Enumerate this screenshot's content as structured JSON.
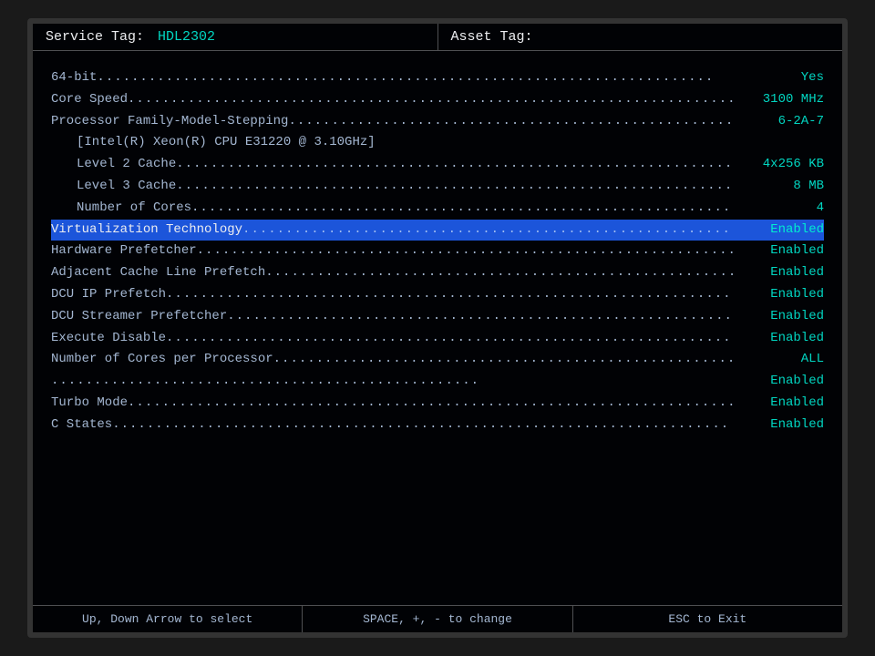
{
  "header": {
    "service_tag_label": "Service Tag:",
    "service_tag_value": "HDL2302",
    "asset_tag_label": "Asset Tag:"
  },
  "rows": [
    {
      "label": "64-bit",
      "dots": true,
      "value": "Yes",
      "highlighted": false,
      "indent": false
    },
    {
      "label": "Core Speed",
      "dots": true,
      "value": "3100 MHz",
      "highlighted": false,
      "indent": false
    },
    {
      "label": "Processor Family-Model-Stepping",
      "dots": true,
      "value": "6-2A-7",
      "highlighted": false,
      "indent": false
    },
    {
      "label": "[Intel(R) Xeon(R) CPU E31220 @ 3.10GHz]",
      "dots": false,
      "value": "",
      "highlighted": false,
      "indent": true
    },
    {
      "label": "Level 2 Cache",
      "dots": true,
      "value": "4x256 KB",
      "highlighted": false,
      "indent": true
    },
    {
      "label": "Level 3 Cache",
      "dots": true,
      "value": "8 MB",
      "highlighted": false,
      "indent": true
    },
    {
      "label": "Number of Cores",
      "dots": true,
      "value": "4",
      "highlighted": false,
      "indent": true
    },
    {
      "label": "Virtualization Technology",
      "dots": true,
      "value": "Enabled",
      "highlighted": true,
      "indent": false
    },
    {
      "label": "Hardware Prefetcher",
      "dots": true,
      "value": "Enabled",
      "highlighted": false,
      "indent": false
    },
    {
      "label": "Adjacent Cache Line Prefetch",
      "dots": true,
      "value": "Enabled",
      "highlighted": false,
      "indent": false
    },
    {
      "label": "DCU IP Prefetch",
      "dots": true,
      "value": "Enabled",
      "highlighted": false,
      "indent": false
    },
    {
      "label": "DCU Streamer Prefetcher",
      "dots": true,
      "value": "Enabled",
      "highlighted": false,
      "indent": false
    },
    {
      "label": "Execute Disable",
      "dots": true,
      "value": "Enabled",
      "highlighted": false,
      "indent": false
    },
    {
      "label": "Number of Cores per Processor",
      "dots": true,
      "value": "ALL",
      "highlighted": false,
      "indent": false
    },
    {
      "label": "",
      "dots": true,
      "value": "Enabled",
      "highlighted": false,
      "indent": false
    },
    {
      "label": "Turbo Mode",
      "dots": true,
      "value": "Enabled",
      "highlighted": false,
      "indent": false
    },
    {
      "label": "C States",
      "dots": true,
      "value": "Enabled",
      "highlighted": false,
      "indent": false
    }
  ],
  "footer": {
    "nav_label": "Up, Down Arrow to select",
    "change_label": "SPACE, +, - to change",
    "exit_label": "ESC to Exit"
  },
  "dots_char": "."
}
